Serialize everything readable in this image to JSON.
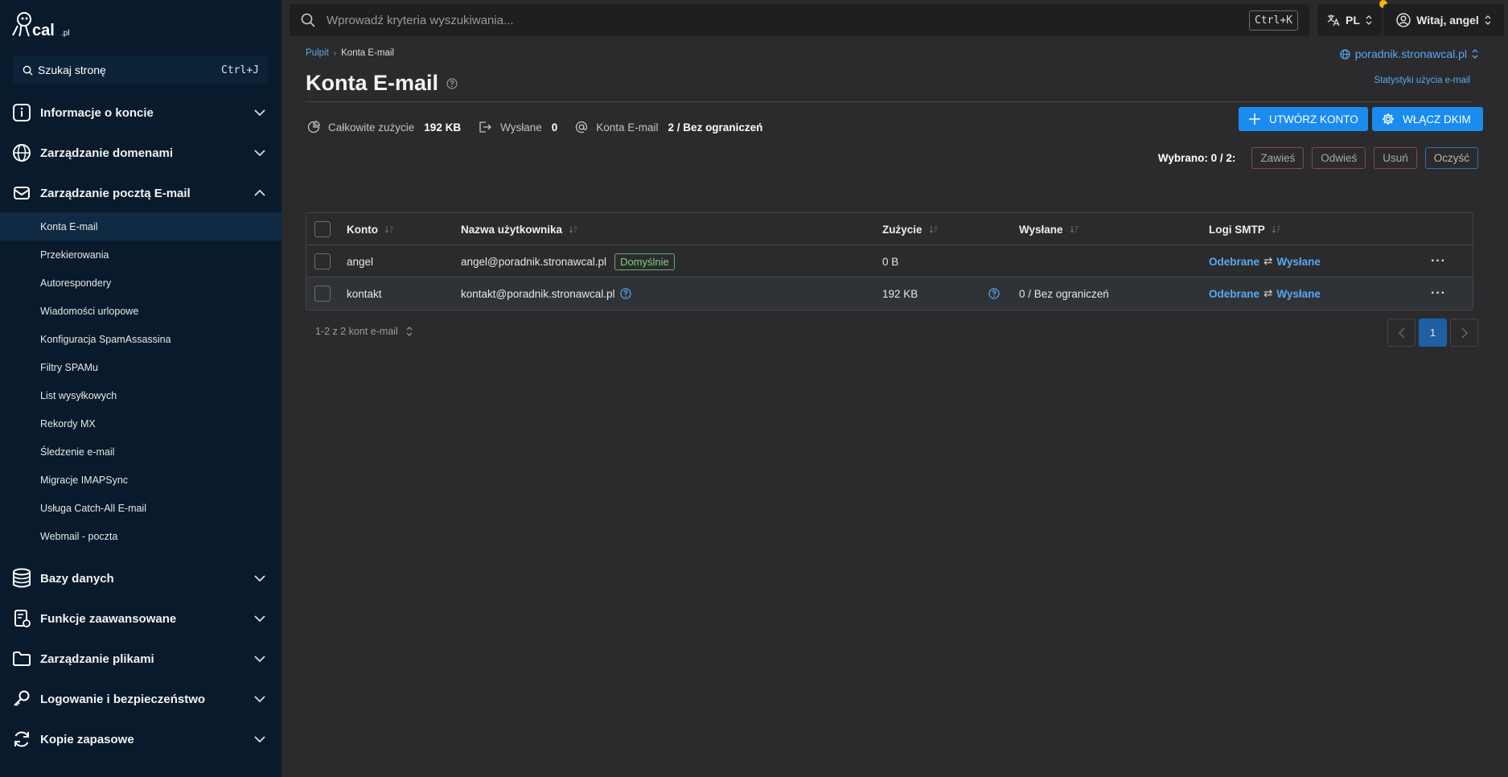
{
  "sidebar": {
    "search": {
      "label": "Szukaj stronę",
      "shortcut": "Ctrl+J"
    },
    "groups": [
      {
        "label": "Informacje o koncie",
        "icon": "info-icon"
      },
      {
        "label": "Zarządzanie domenami",
        "icon": "globe-icon"
      },
      {
        "label": "Zarządzanie pocztą E-mail",
        "icon": "mail-icon"
      },
      {
        "label": "Bazy danych",
        "icon": "database-icon"
      },
      {
        "label": "Funkcje zaawansowane",
        "icon": "advanced-icon"
      },
      {
        "label": "Zarządzanie plikami",
        "icon": "folder-icon"
      },
      {
        "label": "Logowanie i bezpieczeństwo",
        "icon": "key-icon"
      },
      {
        "label": "Kopie zapasowe",
        "icon": "backup-icon"
      }
    ],
    "mail_items": [
      "Konta E-mail",
      "Przekierowania",
      "Autorespondery",
      "Wiadomości urlopowe",
      "Konfiguracja SpamAssassina",
      "Filtry SPAMu",
      "List wysyłkowych",
      "Rekordy MX",
      "Śledzenie e-mail",
      "Migracje IMAPSync",
      "Usługa Catch-All E-mail",
      "Webmail - poczta"
    ]
  },
  "topbar": {
    "search_placeholder": "Wprowadź kryteria wyszukiwania...",
    "shortcut": "Ctrl+K",
    "language": "PL",
    "user": "Witaj, angel"
  },
  "breadcrumb": {
    "home": "Pulpit",
    "current": "Konta E-mail"
  },
  "domain": "poradnik.stronawcal.pl",
  "page_title": "Konta E-mail",
  "stats_link": "Statystyki użycia e-mail",
  "buttons": {
    "create": "UTWÓRZ KONTO",
    "dkim": "WŁĄCZ DKIM"
  },
  "stats": {
    "total_label": "Całkowite zużycie",
    "total_value": "192 KB",
    "sent_label": "Wysłane",
    "sent_value": "0",
    "accounts_label": "Konta E-mail",
    "accounts_value": "2 / Bez ograniczeń"
  },
  "selection": {
    "label": "Wybrano: 0 / 2:",
    "suspend": "Zawieś",
    "unsuspend": "Odwieś",
    "delete": "Usuń",
    "clear": "Oczyść"
  },
  "table": {
    "headers": {
      "account": "Konto",
      "username": "Nazwa użytkownika",
      "usage": "Zużycie",
      "sent": "Wysłane",
      "smtp": "Logi SMTP"
    },
    "rows": [
      {
        "account": "angel",
        "username": "angel@poradnik.stronawcal.pl",
        "badge": "Domyślnie",
        "usage": "0 B",
        "sent": "",
        "received_link": "Odebrane",
        "sent_link": "Wysłane"
      },
      {
        "account": "kontakt",
        "username": "kontakt@poradnik.stronawcal.pl",
        "badge": "",
        "usage": "192 KB",
        "sent": "0 / Bez ograniczeń",
        "received_link": "Odebrane",
        "sent_link": "Wysłane"
      }
    ]
  },
  "pagination": {
    "info": "1-2 z 2 kont e-mail",
    "page": "1"
  },
  "colors": {
    "accent": "#1a8cf0",
    "link": "#5aa8f0",
    "sidebar_bg": "#081a2b",
    "badge": "#7ed07e"
  }
}
